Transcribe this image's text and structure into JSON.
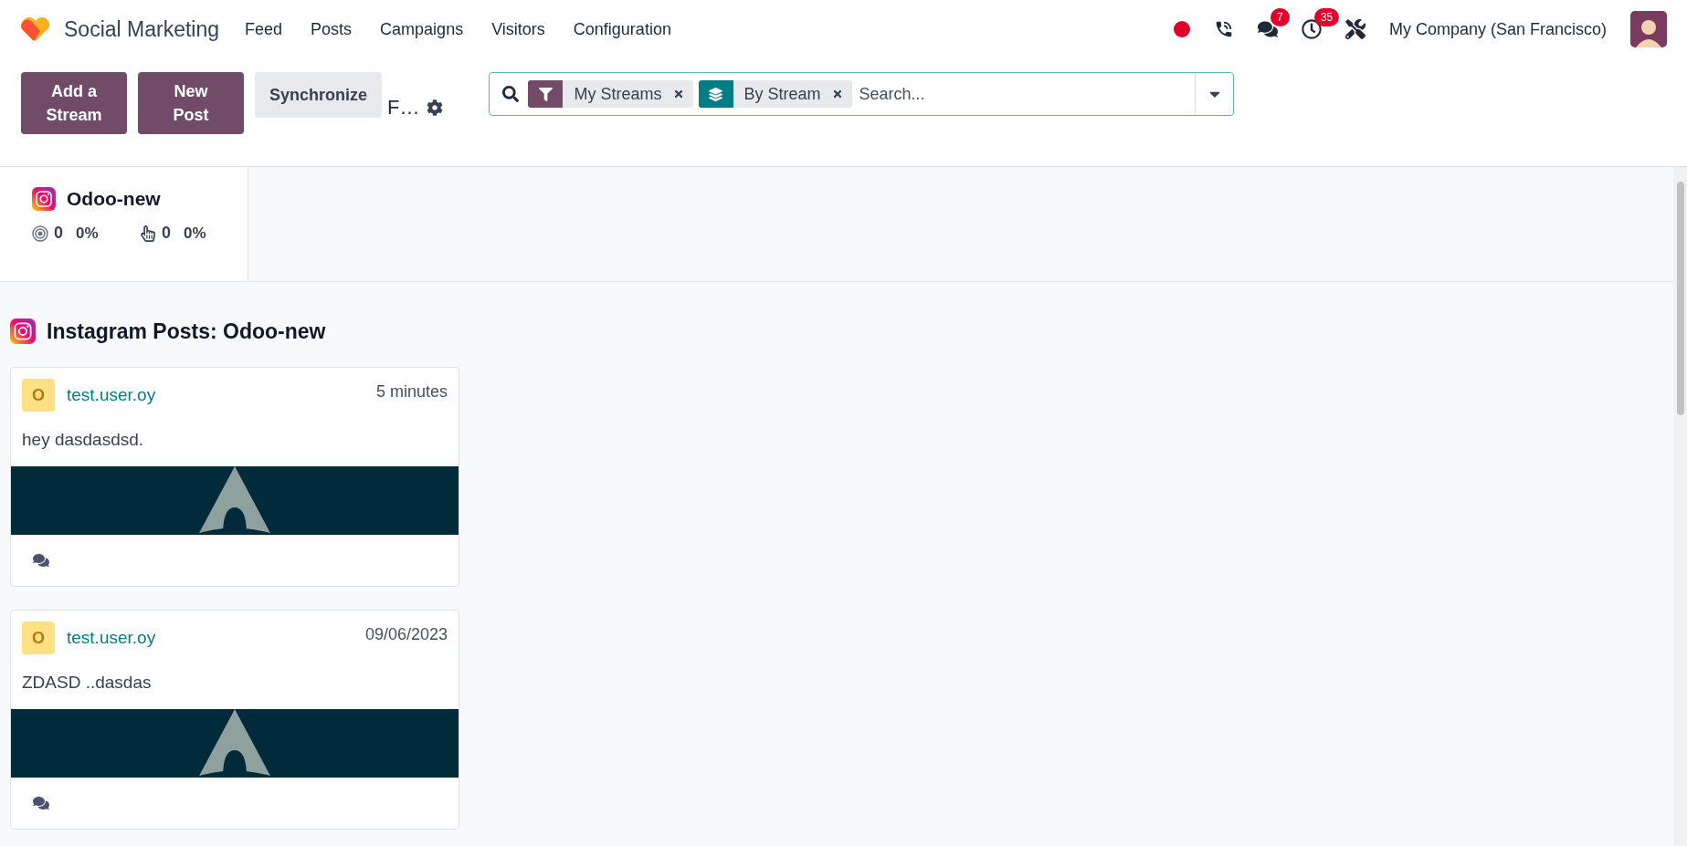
{
  "app": {
    "name": "Social Marketing"
  },
  "menu": [
    "Feed",
    "Posts",
    "Campaigns",
    "Visitors",
    "Configuration"
  ],
  "systray": {
    "chat_count": "7",
    "activity_count": "35",
    "company": "My Company (San Francisco)"
  },
  "actions": [
    {
      "label": "Add a Stream",
      "kind": "primary"
    },
    {
      "label": "New Post",
      "kind": "primary"
    },
    {
      "label": "Synchronize",
      "kind": "secondary"
    }
  ],
  "breadcrumb": "F…",
  "search": {
    "placeholder": "Search...",
    "facets": [
      {
        "kind": "filter",
        "label": "My Streams"
      },
      {
        "kind": "group",
        "label": "By Stream"
      }
    ]
  },
  "streams": [
    {
      "name": "Odoo-new",
      "audience": "0",
      "audience_trend": "0%",
      "engagement": "0",
      "engagement_trend": "0%"
    }
  ],
  "columns": [
    {
      "title": "Instagram Posts: Odoo-new",
      "posts": [
        {
          "author_initial": "O",
          "author": "test.user.oy",
          "time": "5 minutes",
          "text": "hey dasdasdsd."
        },
        {
          "author_initial": "O",
          "author": "test.user.oy",
          "time": "09/06/2023",
          "text": "ZDASD ..dasdas"
        }
      ]
    }
  ]
}
